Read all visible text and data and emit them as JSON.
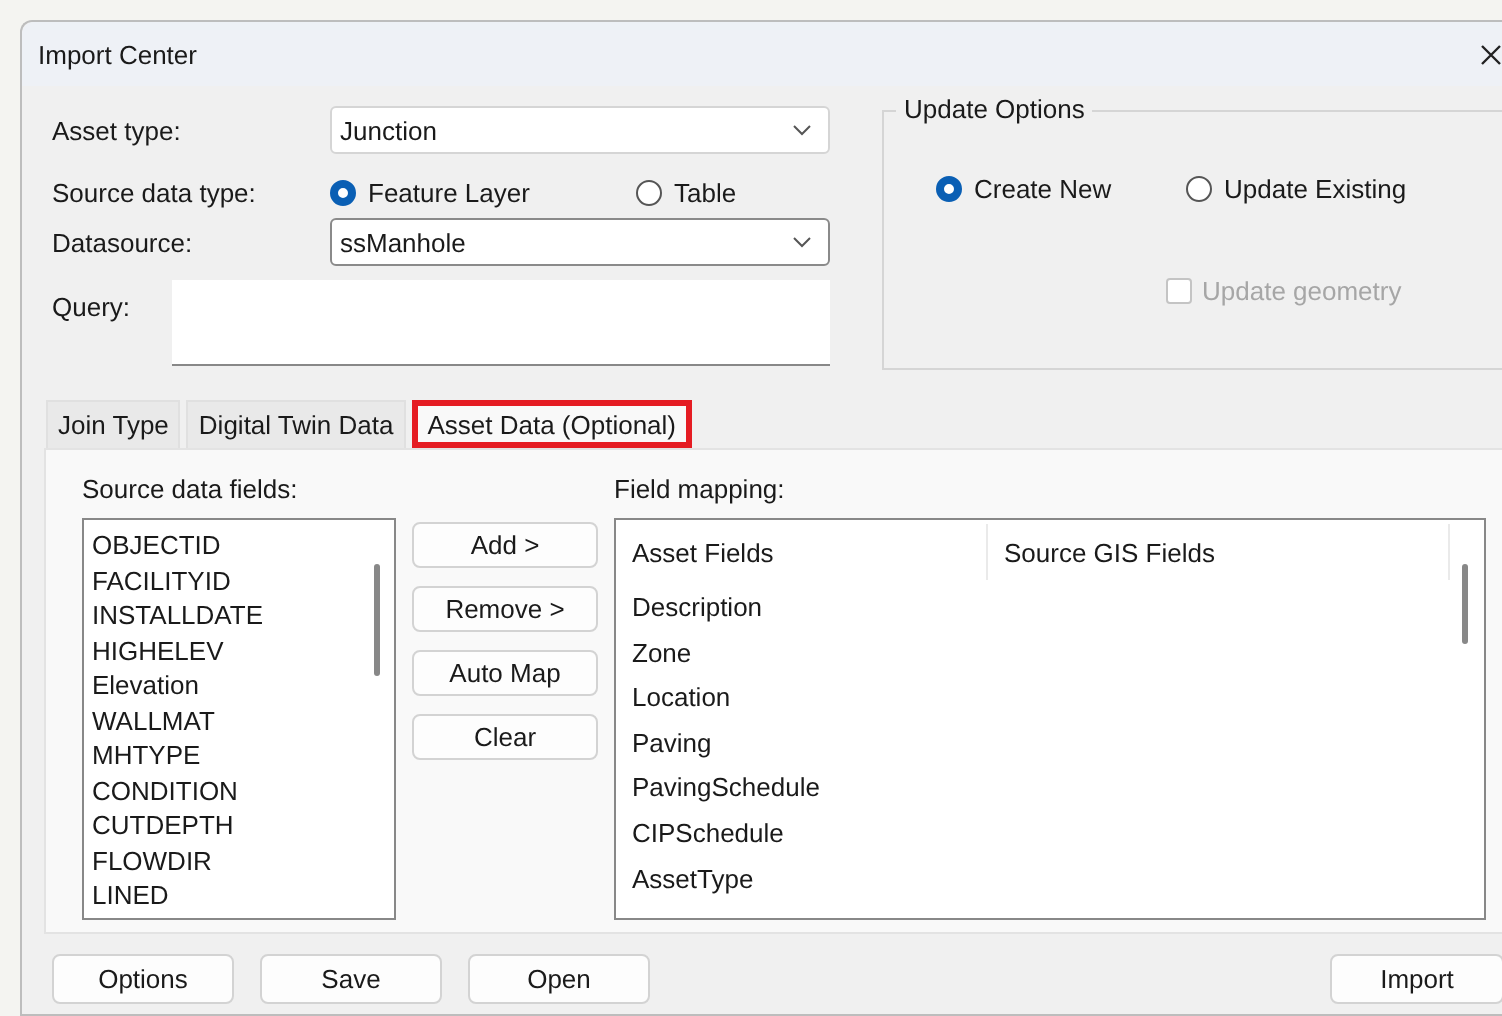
{
  "window": {
    "title": "Import Center"
  },
  "asset_type": {
    "label": "Asset type:",
    "value": "Junction"
  },
  "source_data_type": {
    "label": "Source data type:",
    "options": [
      {
        "label": "Feature Layer",
        "selected": true
      },
      {
        "label": "Table",
        "selected": false
      }
    ]
  },
  "datasource": {
    "label": "Datasource:",
    "value": "ssManhole"
  },
  "query": {
    "label": "Query:"
  },
  "update_options": {
    "title": "Update Options",
    "options": [
      {
        "label": "Create New",
        "selected": true
      },
      {
        "label": "Update Existing",
        "selected": false
      }
    ],
    "update_geometry": {
      "label": "Update geometry",
      "checked": false,
      "disabled": true
    }
  },
  "tabs": [
    {
      "label": "Join Type",
      "selected": false,
      "highlighted": false
    },
    {
      "label": "Digital Twin Data",
      "selected": false,
      "highlighted": false
    },
    {
      "label": "Asset Data (Optional)",
      "selected": true,
      "highlighted": true
    }
  ],
  "source_fields": {
    "label": "Source data fields:",
    "items": [
      "OBJECTID",
      "FACILITYID",
      "INSTALLDATE",
      "HIGHELEV",
      "Elevation",
      "WALLMAT",
      "MHTYPE",
      "CONDITION",
      "CUTDEPTH",
      "FLOWDIR",
      "LINED"
    ]
  },
  "mapping_buttons": [
    "Add >",
    "Remove >",
    "Auto Map",
    "Clear"
  ],
  "field_mapping": {
    "label": "Field mapping:",
    "columns": [
      "Asset Fields",
      "Source GIS Fields"
    ],
    "rows": [
      "Description",
      "Zone",
      "Location",
      "Paving",
      "PavingSchedule",
      "CIPSchedule",
      "AssetType"
    ]
  },
  "footer_buttons_left": [
    "Options",
    "Save",
    "Open"
  ],
  "footer_buttons_right": [
    "Import"
  ]
}
